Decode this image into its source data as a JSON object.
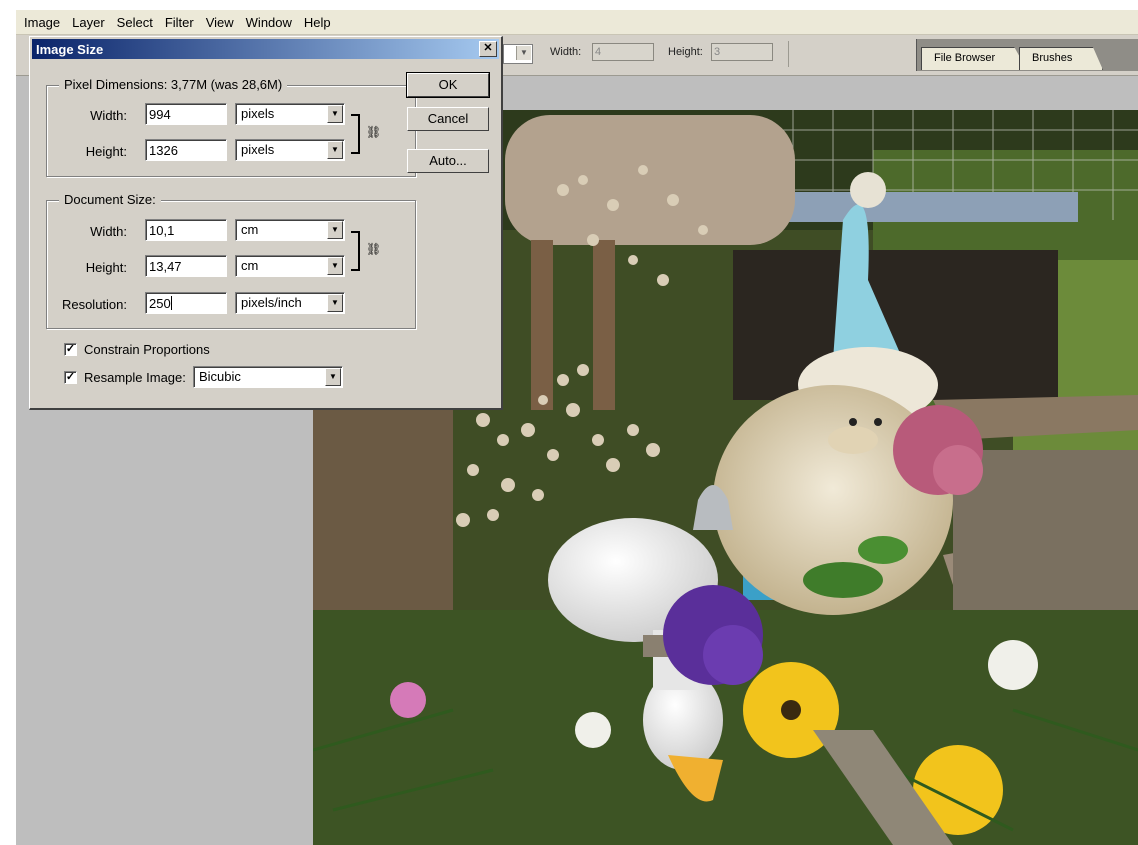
{
  "menu": [
    "Image",
    "Layer",
    "Select",
    "Filter",
    "View",
    "Window",
    "Help"
  ],
  "options_bar": {
    "width_label": "Width:",
    "width_value": "4",
    "height_label": "Height:",
    "height_value": "3"
  },
  "palette_tabs": [
    "File Browser",
    "Brushes"
  ],
  "dialog": {
    "title": "Image Size",
    "close_glyph": "✕",
    "pixel_dimensions": {
      "title": "Pixel Dimensions:  3,77M (was 28,6M)",
      "width_label": "Width:",
      "width_value": "994",
      "width_unit": "pixels",
      "height_label": "Height:",
      "height_value": "1326",
      "height_unit": "pixels"
    },
    "document_size": {
      "title": "Document Size:",
      "width_label": "Width:",
      "width_value": "10,1",
      "width_unit": "cm",
      "height_label": "Height:",
      "height_value": "13,47",
      "height_unit": "cm",
      "resolution_label": "Resolution:",
      "resolution_value": "250",
      "resolution_unit": "pixels/inch"
    },
    "constrain_label": "Constrain Proportions",
    "constrain_checked": "✓",
    "resample_label": "Resample Image:",
    "resample_checked": "✓",
    "resample_method": "Bicubic",
    "ok_label": "OK",
    "cancel_label": "Cancel",
    "auto_label": "Auto..."
  }
}
